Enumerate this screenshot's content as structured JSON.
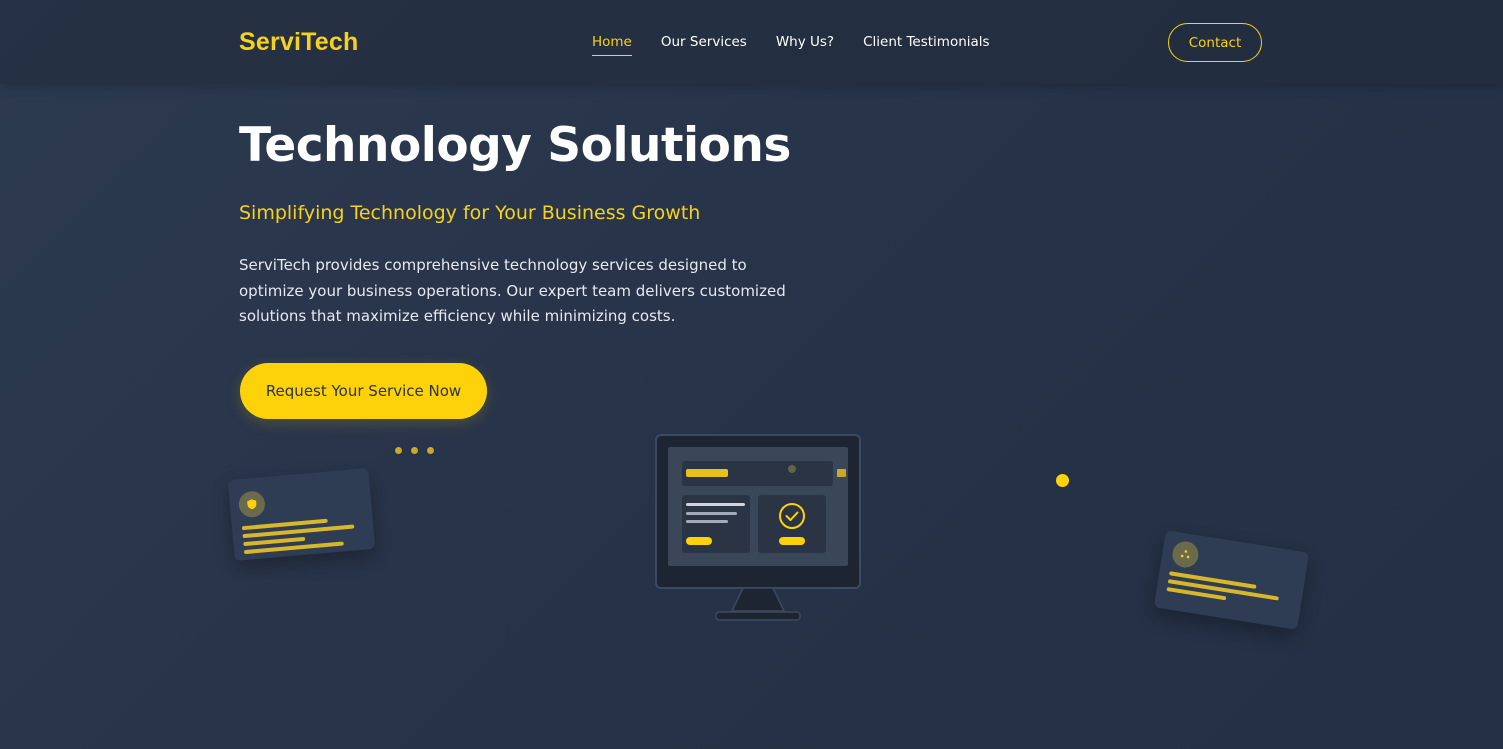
{
  "brand": {
    "name": "ServiTech",
    "accent_color": "#f8d21a",
    "background_color": "#2a3649"
  },
  "nav": {
    "links": [
      {
        "label": "Home",
        "active": true
      },
      {
        "label": "Our Services",
        "active": false
      },
      {
        "label": "Why Us?",
        "active": false
      },
      {
        "label": "Client Testimonials",
        "active": false
      }
    ],
    "contact_label": "Contact"
  },
  "hero": {
    "title": "Technology Solutions",
    "subtitle": "Simplifying Technology for Your Business Growth",
    "description": "ServiTech provides comprehensive technology services designed to optimize your business operations. Our expert team delivers customized solutions that maximize efficiency while minimizing costs.",
    "cta_label": "Request Your Service Now"
  },
  "illustration": {
    "left_card_icon": "shield-icon",
    "right_card_icon": "network-icon",
    "monitor_icon": "checkmark-icon"
  }
}
